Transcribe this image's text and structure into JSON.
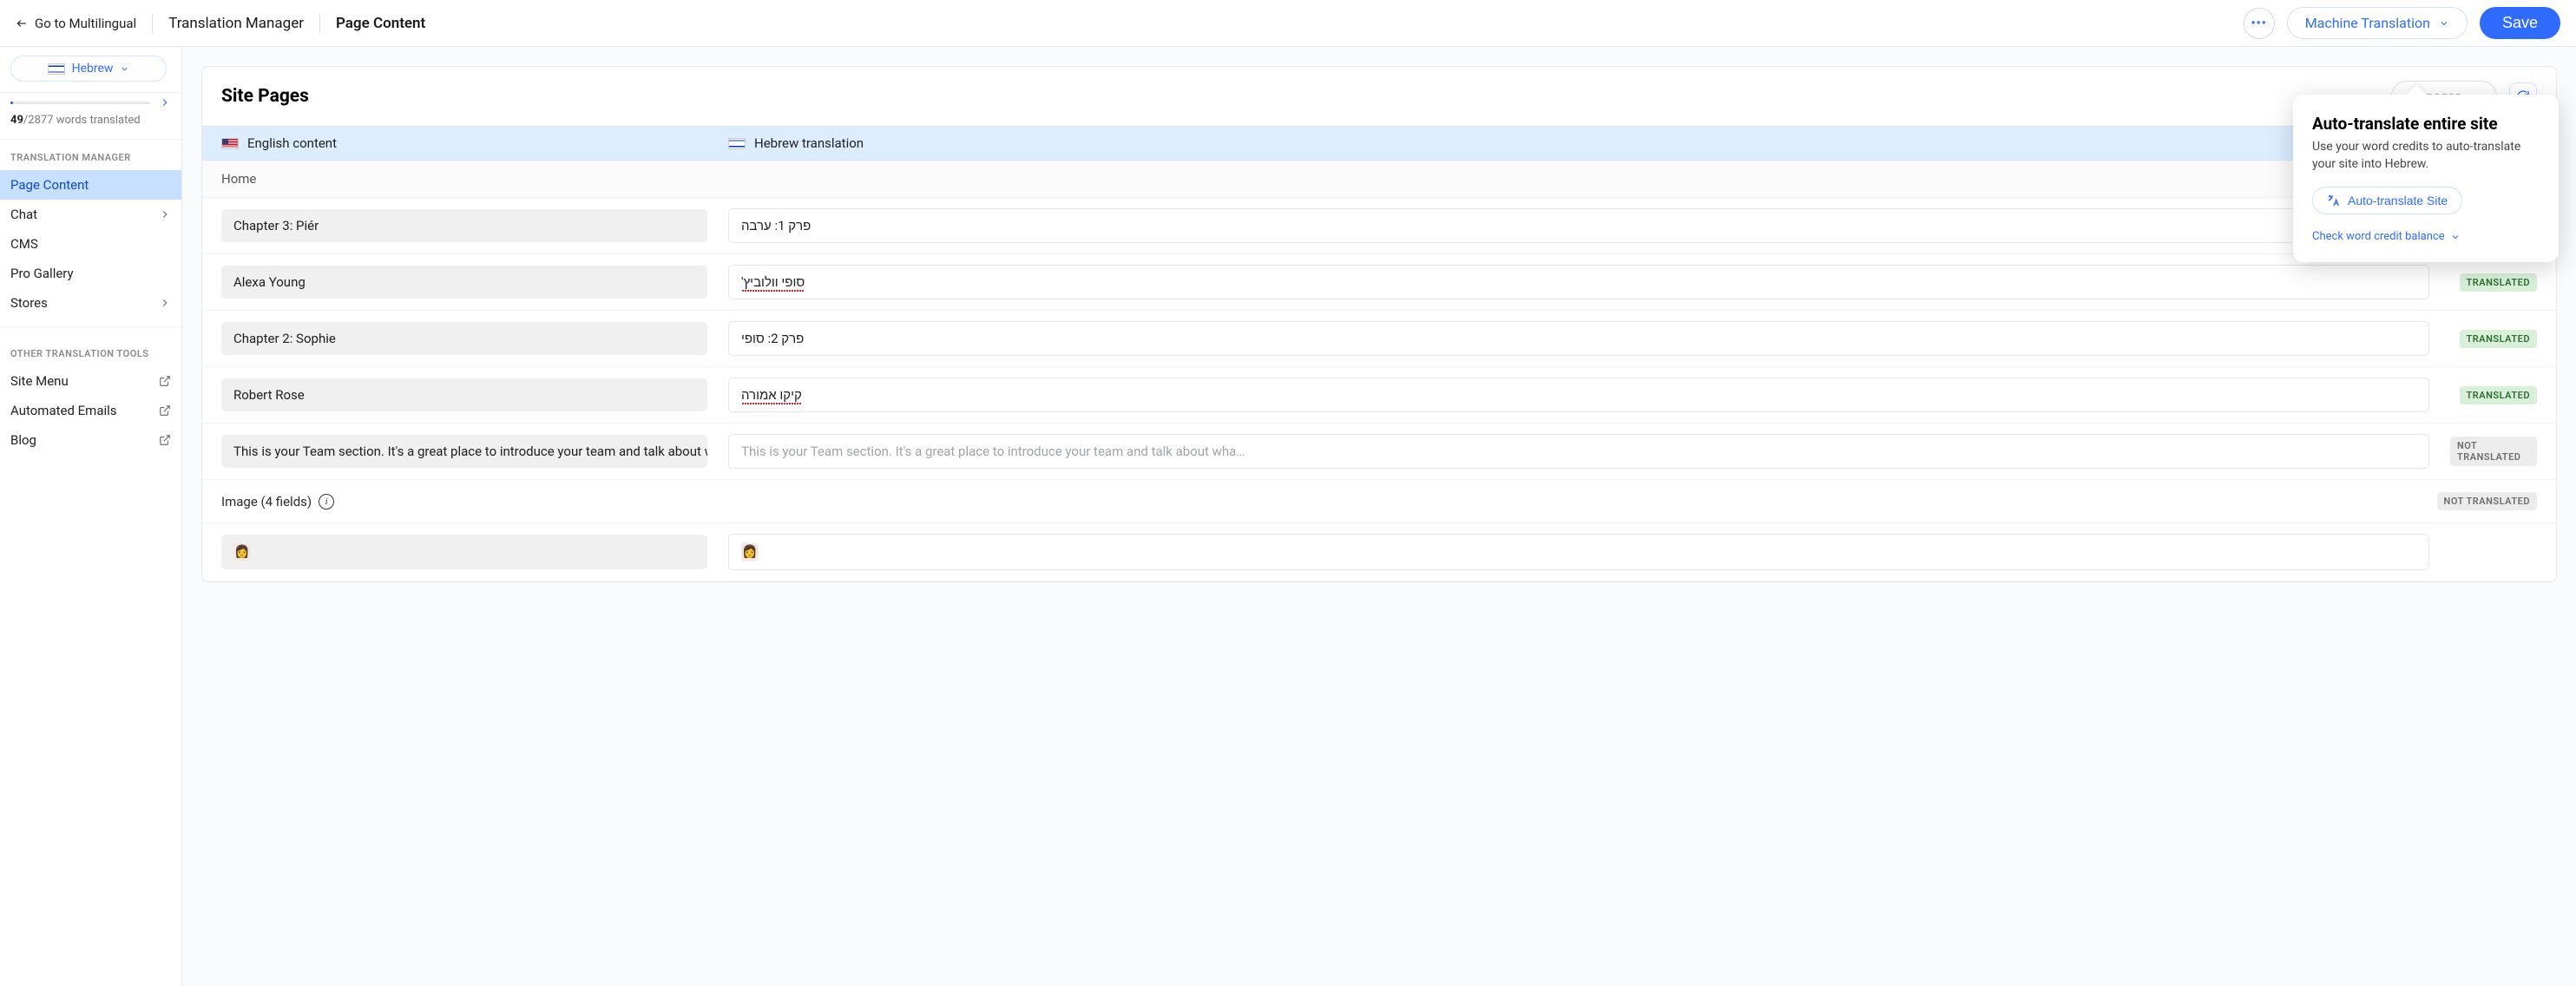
{
  "topbar": {
    "go_back": "Go to Multilingual",
    "crumb1": "Translation Manager",
    "crumb2": "Page Content",
    "machine_translation": "Machine Translation",
    "save": "Save"
  },
  "sidebar": {
    "lang_label": "Hebrew",
    "progress_current": "49",
    "progress_total": "/2877 words translated",
    "group1_title": "TRANSLATION MANAGER",
    "group1_items": [
      {
        "label": "Page Content",
        "kind": "active"
      },
      {
        "label": "Chat",
        "kind": "chev"
      },
      {
        "label": "CMS",
        "kind": "plain"
      },
      {
        "label": "Pro Gallery",
        "kind": "plain"
      },
      {
        "label": "Stores",
        "kind": "chev"
      }
    ],
    "group2_title": "OTHER TRANSLATION TOOLS",
    "group2_items": [
      {
        "label": "Site Menu",
        "kind": "ext"
      },
      {
        "label": "Automated Emails",
        "kind": "ext"
      },
      {
        "label": "Blog",
        "kind": "ext"
      }
    ]
  },
  "panel": {
    "title": "Site Pages",
    "all_pages": "All pages",
    "col_src": "English content",
    "col_dst": "Hebrew translation",
    "section": "Home",
    "rows": [
      {
        "src": "Chapter 3: Piér",
        "dst": "פרק 1: ערבה",
        "status": "TRANSLATED",
        "ok": true
      },
      {
        "src": "Alexa Young",
        "dst": "סופי וולוביץ'",
        "status": "TRANSLATED",
        "ok": true,
        "squiggle": true
      },
      {
        "src": "Chapter 2: Sophie",
        "dst": "פרק 2: סופי",
        "status": "TRANSLATED",
        "ok": true
      },
      {
        "src": "Robert Rose",
        "dst": "קיקו אמורה",
        "status": "TRANSLATED",
        "ok": true,
        "squiggle": true
      },
      {
        "src": "This is your Team section. It's a great place to introduce your team and talk about wh…",
        "dst": "This is your Team section. It's a great place to introduce your team and talk about wha…",
        "status": "NOT TRANSLATED",
        "ok": false,
        "placeholder": true
      }
    ],
    "image_group_label": "Image (4 fields)",
    "image_group_status": "NOT TRANSLATED"
  },
  "popover": {
    "title": "Auto-translate entire site",
    "desc": "Use your word credits to auto-translate your site into Hebrew.",
    "button": "Auto-translate Site",
    "credit_link": "Check word credit balance"
  }
}
